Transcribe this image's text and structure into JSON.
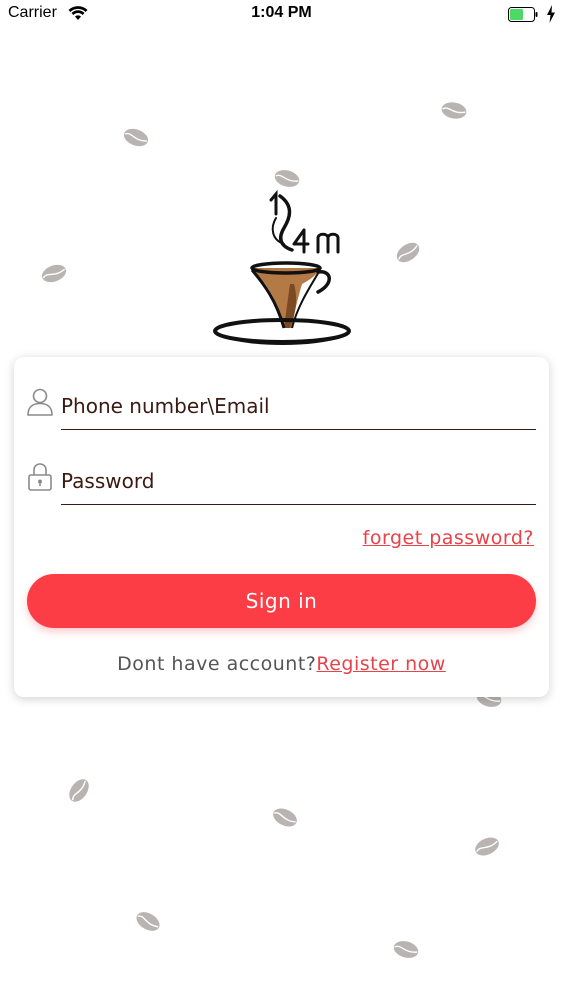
{
  "status_bar": {
    "carrier": "Carrier",
    "time": "1:04 PM",
    "battery_color": "#4cd964"
  },
  "login": {
    "account_placeholder": "Phone number\\Email",
    "password_placeholder": "Password",
    "forget_password": "forget password?",
    "sign_in": "Sign in",
    "register_prompt": "Dont have account?",
    "register_link": "Register now"
  },
  "colors": {
    "accent": "#fc3d45",
    "link": "#e8424a",
    "text": "#3a1a12",
    "bean": "#b9b3b2"
  },
  "icons": {
    "account": "user-icon",
    "password": "lock-icon"
  }
}
